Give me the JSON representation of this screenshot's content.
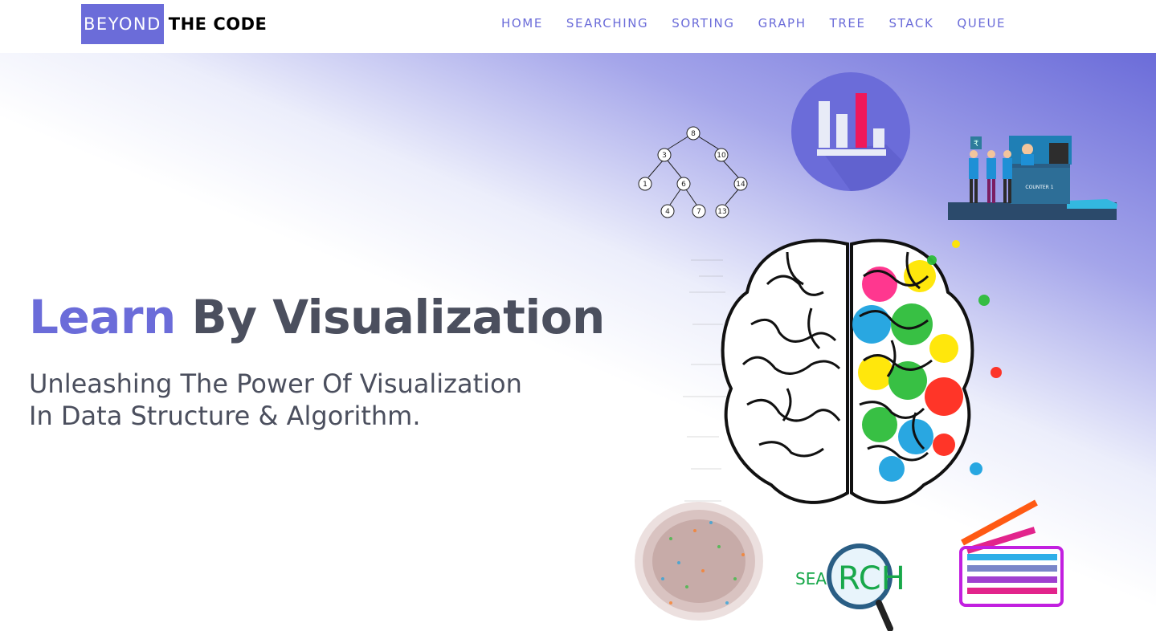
{
  "brand": {
    "part1": "BEYOND",
    "part2": "THE CODE"
  },
  "nav": {
    "items": [
      {
        "label": "HOME"
      },
      {
        "label": "SEARCHING"
      },
      {
        "label": "SORTING"
      },
      {
        "label": "GRAPH"
      },
      {
        "label": "TREE"
      },
      {
        "label": "STACK"
      },
      {
        "label": "QUEUE"
      }
    ]
  },
  "hero": {
    "title_accent": "Learn",
    "title_rest": " By Visualization",
    "subtitle": "Unleashing The Power Of Visualization In Data Structure & Algorithm."
  },
  "illustrations": {
    "tree_nodes": [
      "8",
      "3",
      "10",
      "1",
      "6",
      "14",
      "4",
      "7",
      "13"
    ],
    "queue_counter_label": "COUNTER 1",
    "search_label_green": "SEA",
    "search_label_lens": "RCH"
  },
  "colors": {
    "accent": "#6b6cd9",
    "text": "#4b4f5e",
    "chart_bar_highlight": "#f0185a",
    "search_green": "#18a84a"
  }
}
